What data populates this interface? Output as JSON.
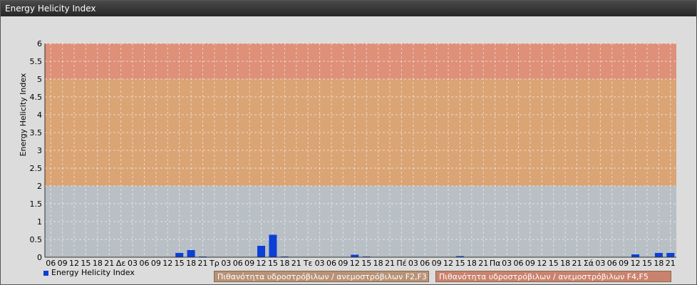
{
  "window": {
    "title": "Energy Helicity Index"
  },
  "colors": {
    "bar": "#0b3fd6",
    "band_low": "#b6bec4",
    "band_mid": "#dca06c",
    "band_high": "#e08a70"
  },
  "legend": {
    "series_label": "Energy Helicity Index",
    "band_mid_label": "Πιθανότητα υδροστρόβιλων / ανεμοστρόβιλων F2,F3",
    "band_high_label": "Πιθανότητα υδροστρόβιλων / ανεμοστρόβιλων F4,F5"
  },
  "chart_data": {
    "type": "bar",
    "ylabel": "Energy Helicity Index",
    "ylim": [
      0,
      6
    ],
    "yticks": [
      "0",
      "0.5",
      "1",
      "1.5",
      "2",
      "2.5",
      "3",
      "3.5",
      "4",
      "4.5",
      "5",
      "5.5",
      "6"
    ],
    "bands": [
      {
        "from": 0,
        "to": 2
      },
      {
        "from": 2,
        "to": 5
      },
      {
        "from": 5,
        "to": 6
      }
    ],
    "categories": [
      "06",
      "09",
      "12",
      "15",
      "18",
      "21",
      "Δε",
      "03",
      "06",
      "09",
      "12",
      "15",
      "18",
      "21",
      "Τρ",
      "03",
      "06",
      "09",
      "12",
      "15",
      "18",
      "21",
      "Τε",
      "03",
      "06",
      "09",
      "12",
      "15",
      "18",
      "21",
      "Πέ",
      "03",
      "06",
      "09",
      "12",
      "15",
      "18",
      "21",
      "Πα",
      "03",
      "06",
      "09",
      "12",
      "15",
      "18",
      "21",
      "Σά",
      "03",
      "06",
      "09",
      "12",
      "15",
      "18",
      "21"
    ],
    "values": [
      0.01,
      0.01,
      0.01,
      0.01,
      0.01,
      0.01,
      0.01,
      0.01,
      0.01,
      0.01,
      0.01,
      0.12,
      0.2,
      0.02,
      0.01,
      0.01,
      0.01,
      0.01,
      0.32,
      0.63,
      0.02,
      0.01,
      0.01,
      0.01,
      0.01,
      0.01,
      0.07,
      0.02,
      0.01,
      0.01,
      0.01,
      0.01,
      0.01,
      0.01,
      0.01,
      0.03,
      0.01,
      0.01,
      0.01,
      0.01,
      0.01,
      0.01,
      0.01,
      0.01,
      0.01,
      0.01,
      0.01,
      0.01,
      0.01,
      0.01,
      0.08,
      0.01,
      0.12,
      0.12
    ]
  }
}
